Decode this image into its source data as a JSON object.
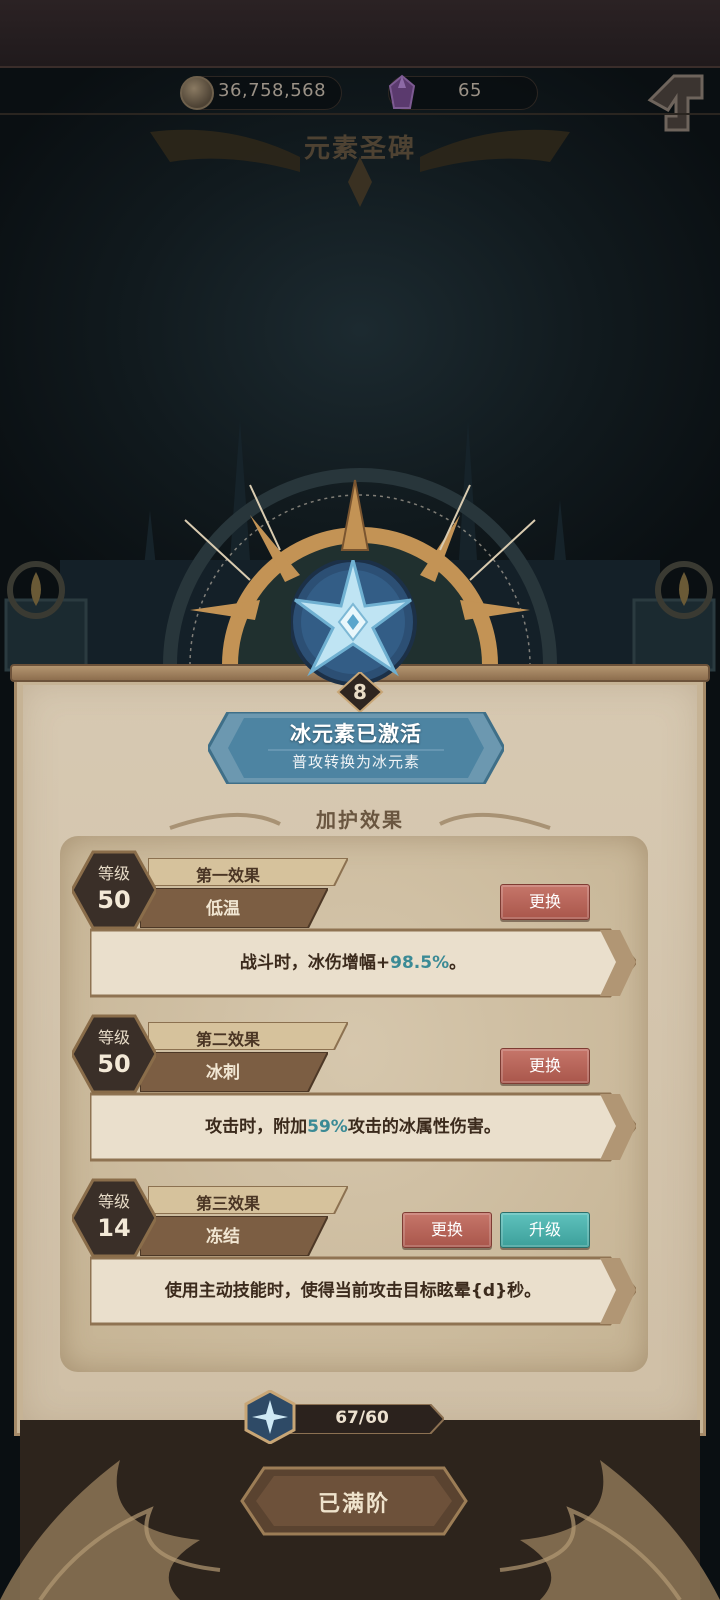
{
  "header": {
    "gold_amount": "36,758,568",
    "gem_amount": "65",
    "title": "元素圣碑",
    "gold_icon": "coin-icon",
    "gem_icon": "purple-crystal-icon",
    "back_icon": "back-arrow-icon"
  },
  "shrine": {
    "element_icon": "ice-snowflake-star-icon",
    "level": "8",
    "banner_title": "冰元素已激活",
    "banner_subtitle": "普攻转换为冰元素"
  },
  "section_title": "加护效果",
  "effects": [
    {
      "level_label": "等级",
      "level_value": "50",
      "tag": "第一效果",
      "name": "低温",
      "desc_before": "战斗时，冰伤增幅+",
      "desc_highlight": "98.5%",
      "desc_after": "。",
      "replace_label": "更换"
    },
    {
      "level_label": "等级",
      "level_value": "50",
      "tag": "第二效果",
      "name": "冰刺",
      "desc_before": "攻击时，附加",
      "desc_highlight": "59%",
      "desc_after": "攻击的冰属性伤害。",
      "replace_label": "更换"
    },
    {
      "level_label": "等级",
      "level_value": "14",
      "tag": "第三效果",
      "name": "冻结",
      "desc_before": "使用主动技能时，使得当前攻击目标眩晕{d}秒。",
      "desc_highlight": "",
      "desc_after": "",
      "replace_label": "更换",
      "upgrade_label": "升级"
    }
  ],
  "progress": {
    "current": "67",
    "separator": "/",
    "max": "60"
  },
  "maxed_label": "已满阶",
  "colors": {
    "replace_button": "#b25f53",
    "upgrade_button": "#46aba6",
    "highlight_text": "#3b8a95",
    "parchment": "#d3c4ab"
  }
}
